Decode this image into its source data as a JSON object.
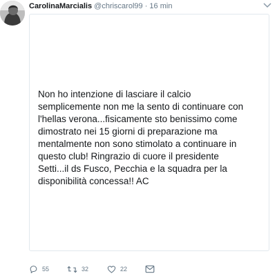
{
  "user": {
    "display_name": "CarolinaMarcialis",
    "handle": "@chriscarol99",
    "separator": "·",
    "time": "16 min"
  },
  "tweet": {
    "text_lines": [
      "Non ho intenzione di lasciare il calcio",
      "semplicemente non me la sento di continuare con",
      "l'hellas verona...fisicamente sto benissimo come",
      "dimostrato nei 15 giorni di preparazione ma",
      "mentalmente non sono stimolato a continuare in",
      "questo club! Ringrazio di cuore il presidente",
      "Setti...il ds Fusco, Pecchia e la squadra per la",
      "disponibilità concessa!! AC"
    ]
  },
  "actions": {
    "replies": "55",
    "retweets": "32",
    "likes": "22"
  },
  "icons": {
    "reply": "reply-icon",
    "retweet": "retweet-icon",
    "like": "heart-icon",
    "dm": "envelope-icon",
    "menu": "chevron-down-icon"
  },
  "colors": {
    "text": "#14171a",
    "muted": "#657786",
    "border": "#e1e8ed"
  }
}
